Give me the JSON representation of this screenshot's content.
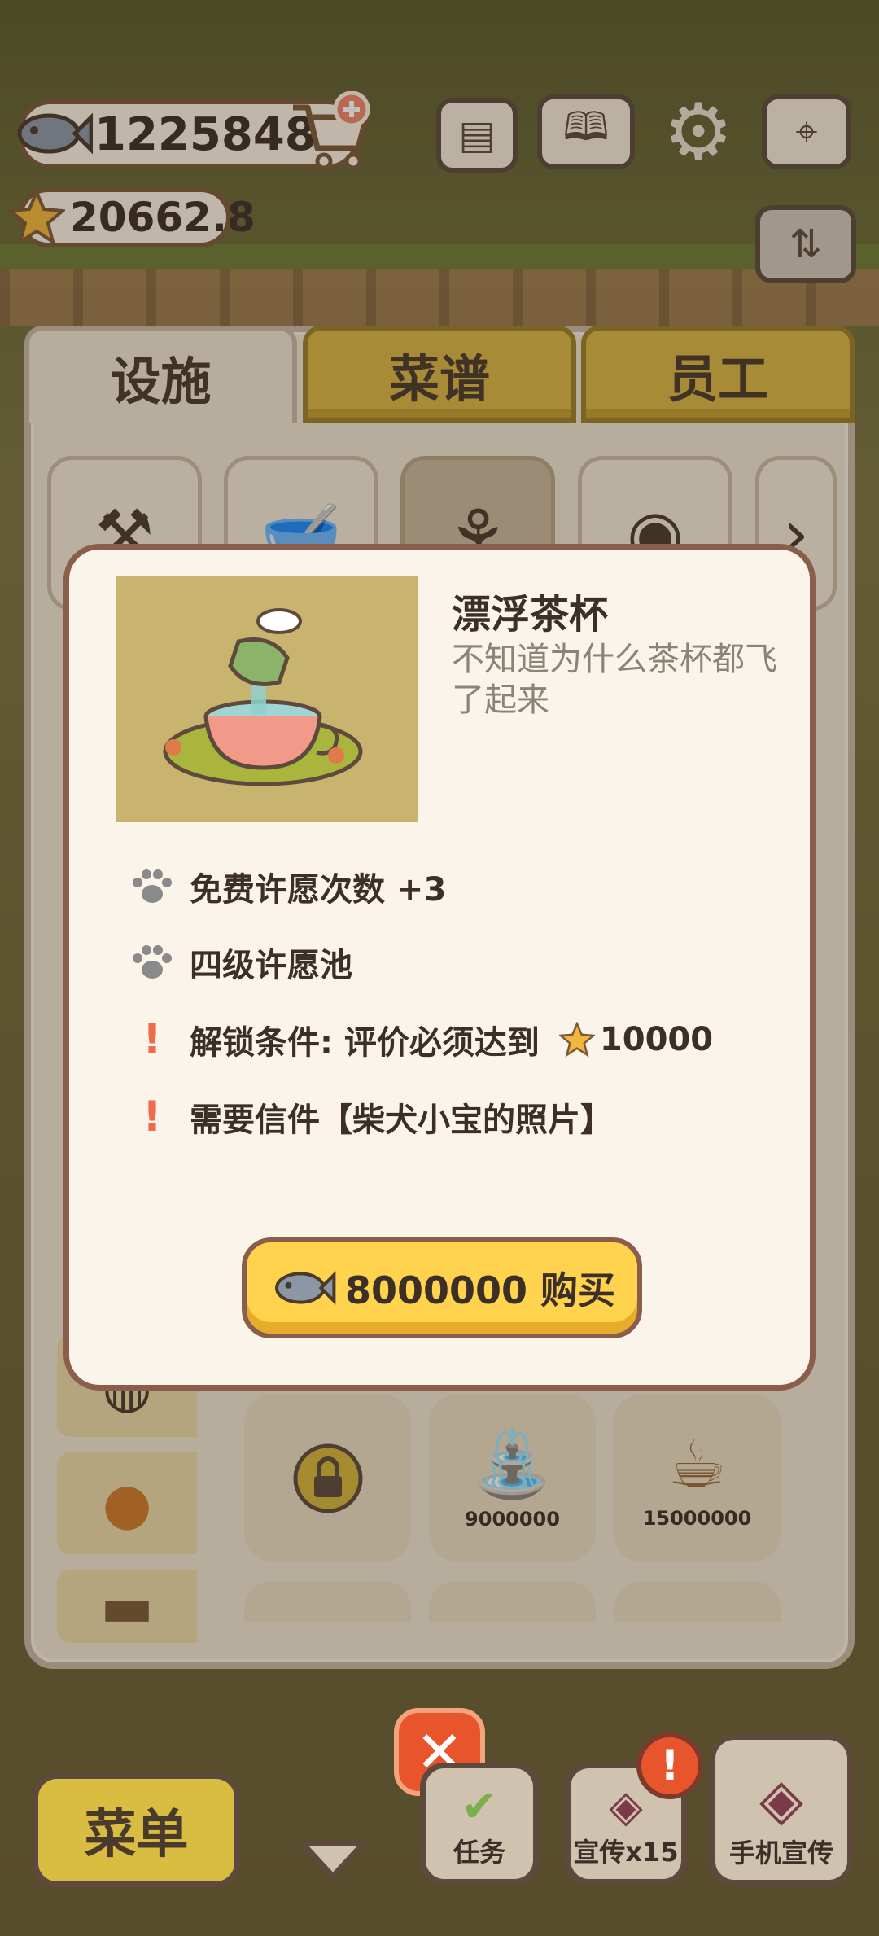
{
  "hud": {
    "fish_amount": "12258481",
    "star_amount": "20662.8"
  },
  "tabs": [
    {
      "label": "设施"
    },
    {
      "label": "菜谱"
    },
    {
      "label": "员工"
    }
  ],
  "grid_items": [
    {
      "price": "9000000"
    },
    {
      "price": "15000000"
    }
  ],
  "modal": {
    "title": "漂浮茶杯",
    "description": "不知道为什么茶杯都飞了起来",
    "attributes": [
      {
        "icon": "paw-icon",
        "text": "免费许愿次数 +3"
      },
      {
        "icon": "paw-icon",
        "text": "四级许愿池"
      },
      {
        "icon": "exclamation-icon",
        "text": "解锁条件: 评价必须达到",
        "value": "10000"
      },
      {
        "icon": "exclamation-icon",
        "text": "需要信件【柴犬小宝的照片】"
      }
    ],
    "buy_label": "8000000 购买"
  },
  "bottom": {
    "menu_label": "菜单",
    "task_label": "任务",
    "promo_label": "宣传x15",
    "phone_promo_label": "手机宣传"
  },
  "colors": {
    "accent_yellow": "#ffd34d",
    "close_orange": "#e8552c",
    "border_brown": "#8a5e4a"
  }
}
